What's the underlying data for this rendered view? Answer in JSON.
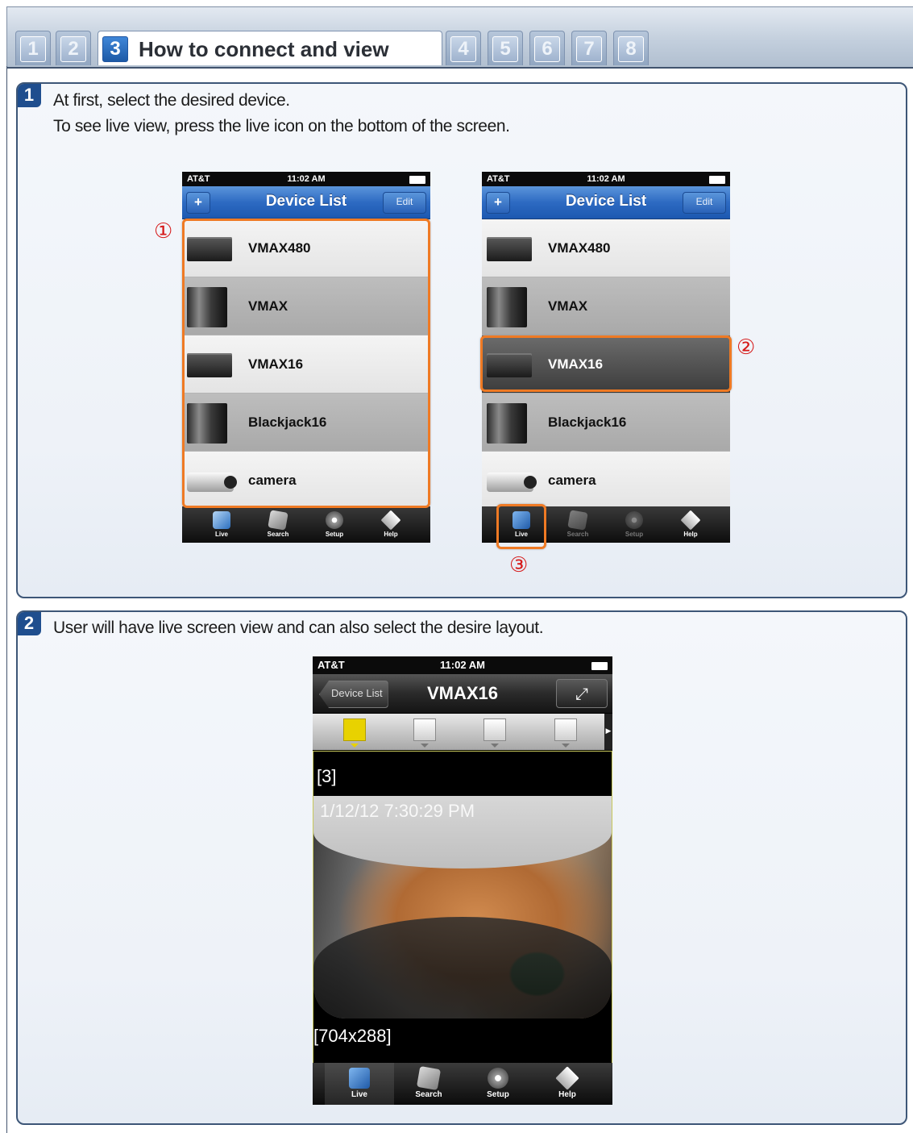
{
  "steps": [
    {
      "num": "1"
    },
    {
      "num": "2"
    },
    {
      "num": "3",
      "title": "How to connect and view"
    },
    {
      "num": "4"
    },
    {
      "num": "5"
    },
    {
      "num": "6"
    },
    {
      "num": "7"
    },
    {
      "num": "8"
    }
  ],
  "step1": {
    "badge": "1",
    "line1": "At first, select the desired device.",
    "line2": "To see live view, press the live icon on the bottom of the screen.",
    "marks": [
      "①",
      "②",
      "③"
    ]
  },
  "step2": {
    "badge": "2",
    "line1": "User will have live screen view and can also select the desire layout."
  },
  "device_screen": {
    "carrier": "AT&T",
    "time": "11:02 AM",
    "title": "Device List",
    "add_label": "+",
    "edit_label": "Edit",
    "devices": [
      {
        "name": "VMAX480",
        "icon": "dvr-icon"
      },
      {
        "name": "VMAX",
        "icon": "tower-icon"
      },
      {
        "name": "VMAX16",
        "icon": "dvr-icon"
      },
      {
        "name": "Blackjack16",
        "icon": "tower-icon"
      },
      {
        "name": "camera",
        "icon": "camera-icon"
      }
    ],
    "selected_device": "VMAX16",
    "tabs": [
      "Live",
      "Search",
      "Setup",
      "Help"
    ]
  },
  "live_screen": {
    "carrier": "AT&T",
    "time": "11:02 AM",
    "back_label": "Device List",
    "title": "VMAX16",
    "fullscreen_icon": "expand-icon",
    "layouts": [
      "1-split",
      "4-split",
      "9-split",
      "16-split"
    ],
    "selected_layout": "1-split",
    "channel": "[3]",
    "timestamp": "1/12/12 7:30:29 PM",
    "resolution": "[704x288]",
    "tabs": [
      "Live",
      "Search",
      "Setup",
      "Help"
    ]
  },
  "colors": {
    "callout": "#ef7a24",
    "marker": "#d61a1a",
    "step_badge": "#1f4e8e",
    "navbar_blue": "#2d6ac2"
  }
}
